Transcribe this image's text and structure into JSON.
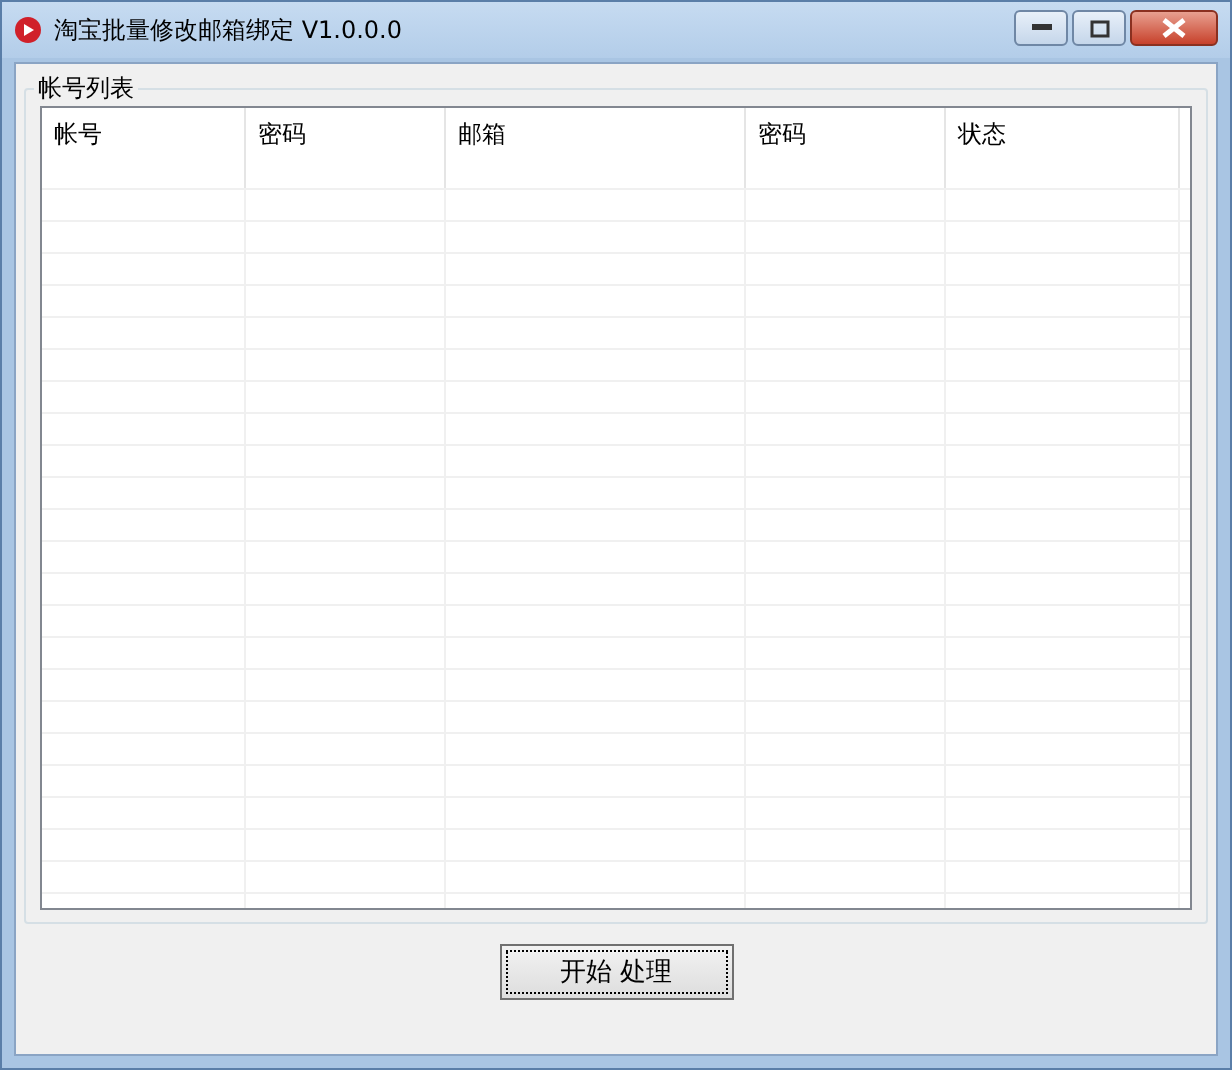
{
  "window": {
    "title": "淘宝批量修改邮箱绑定 V1.0.0.0"
  },
  "group": {
    "label": "帐号列表"
  },
  "table": {
    "columns": [
      "帐号",
      "密码",
      "邮箱",
      "密码",
      "状态"
    ]
  },
  "buttons": [
    "开始  处理"
  ]
}
